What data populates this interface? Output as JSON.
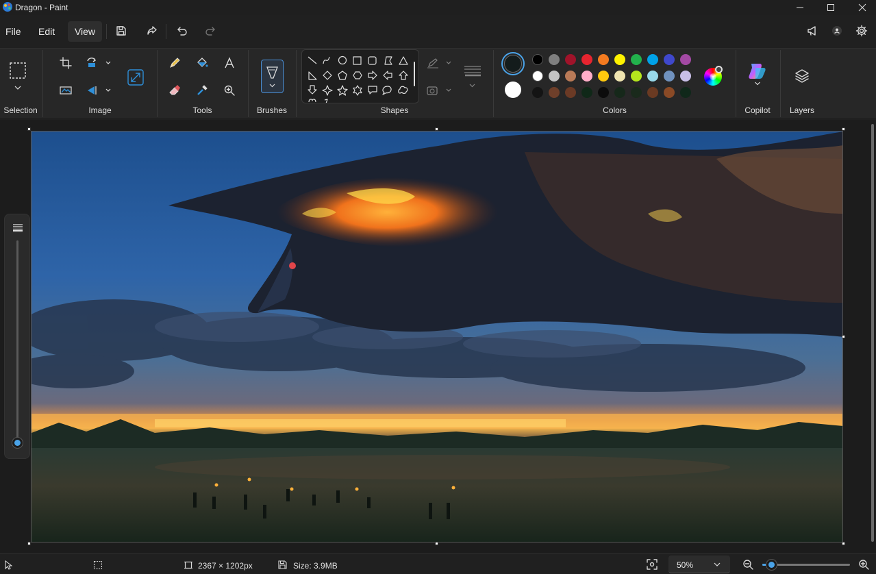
{
  "window": {
    "title": "Dragon - Paint"
  },
  "menu": {
    "file": "File",
    "edit": "Edit",
    "view": "View"
  },
  "ribbon": {
    "groups": {
      "selection": "Selection",
      "image": "Image",
      "tools": "Tools",
      "brushes": "Brushes",
      "shapes": "Shapes",
      "colors": "Colors",
      "copilot": "Copilot",
      "layers": "Layers"
    }
  },
  "colors": {
    "primary": "#141c1c",
    "secondary": "#ffffff",
    "palette_rows": [
      [
        "#000000",
        "#7f7f7f",
        "#a0132a",
        "#e6242f",
        "#f47b20",
        "#fff200",
        "#22b14c",
        "#00a2e8",
        "#3f48cc",
        "#a349a4"
      ],
      [
        "#ffffff",
        "#c3c3c3",
        "#b97a57",
        "#ffaec9",
        "#ffc90e",
        "#efe4b0",
        "#b5e61d",
        "#99d9ea",
        "#7092be",
        "#c8bfe7"
      ],
      [
        "#141414",
        "#6e3f2a",
        "#6b3a25",
        "#102818",
        "#0c0c0c",
        "#16281a",
        "#1a2a1c",
        "#6a3a22",
        "#8a4a26",
        "#10281a"
      ]
    ]
  },
  "status": {
    "dimensions": "2367 × 1202px",
    "size": "Size: 3.9MB",
    "zoom": "50%",
    "zoom_slider_fraction": 0.1
  },
  "icons": {
    "app": "paint-app-icon",
    "save": "save-icon",
    "share": "share-icon",
    "undo": "undo-icon",
    "redo": "redo-icon"
  }
}
